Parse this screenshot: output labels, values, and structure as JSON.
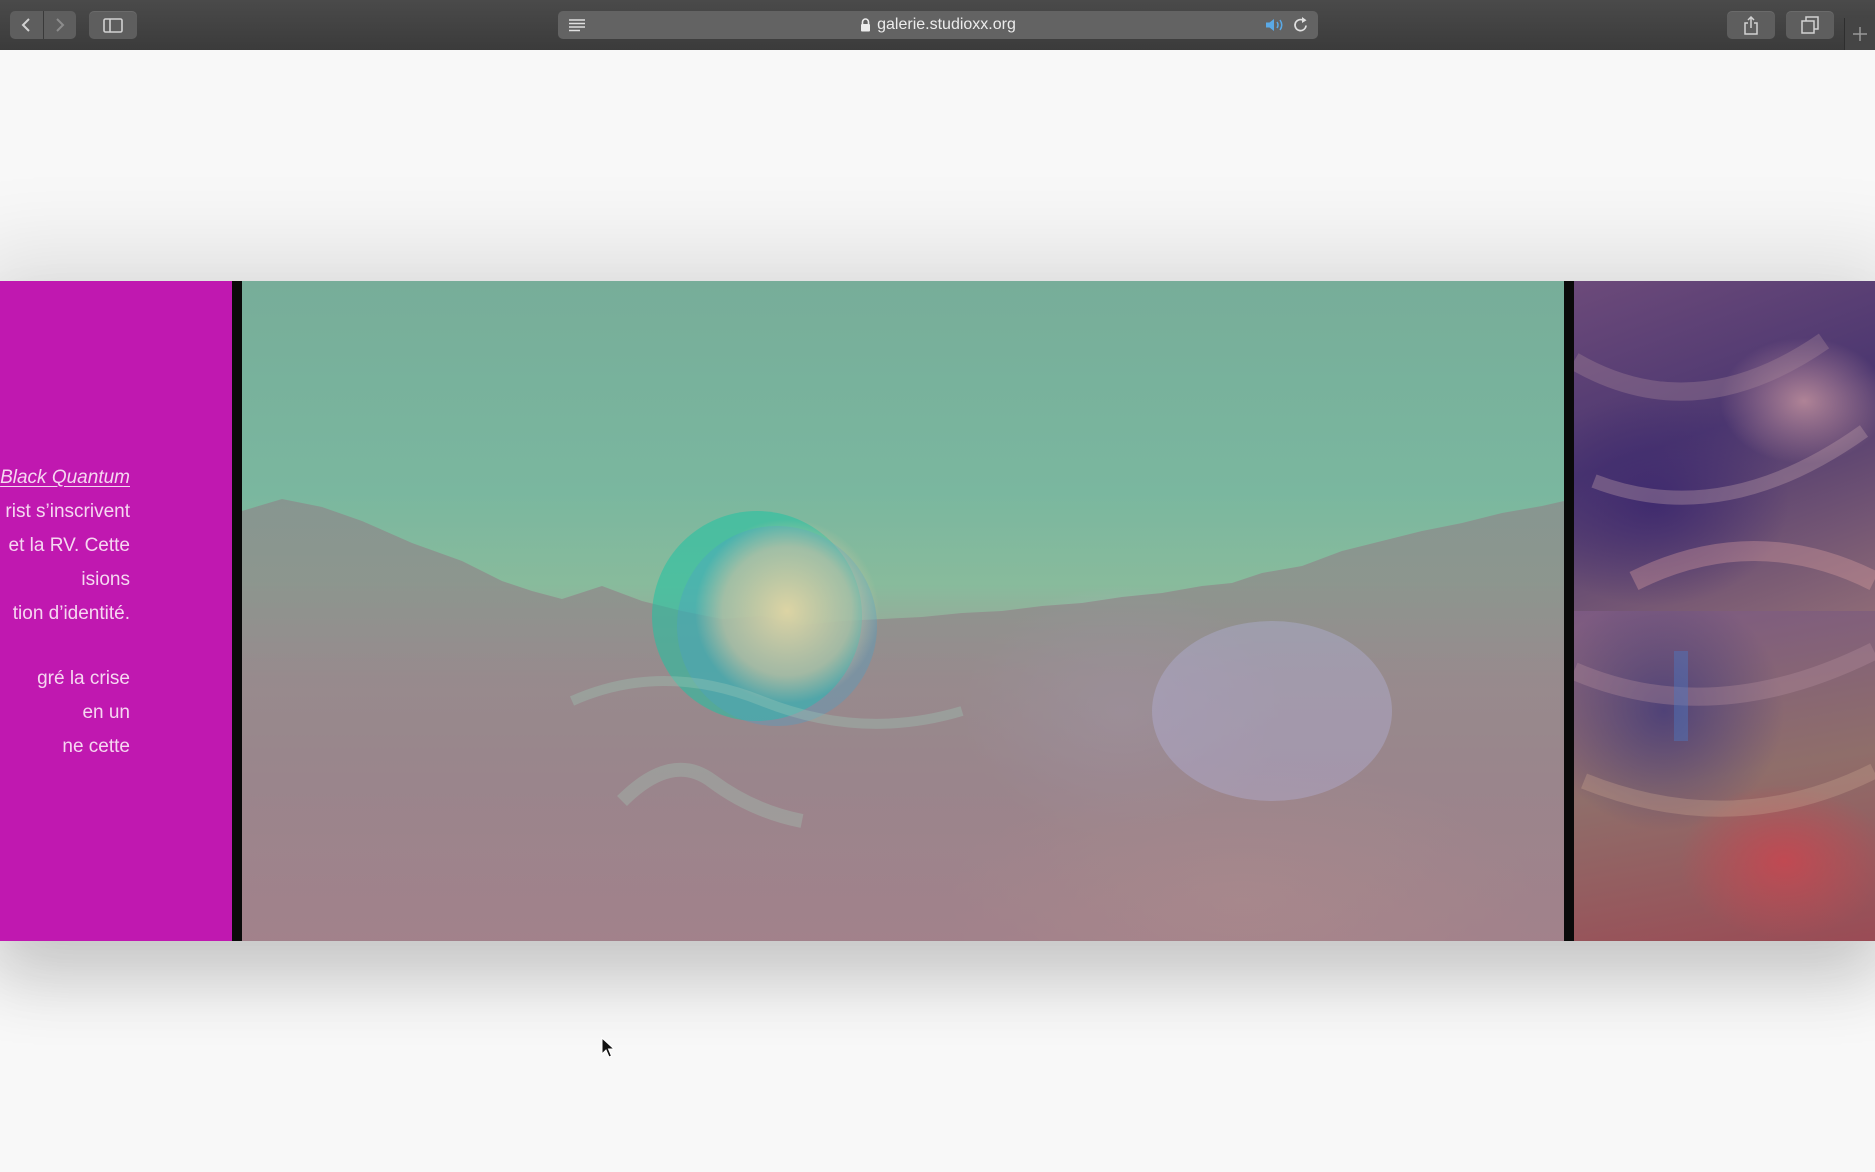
{
  "browser": {
    "url": "galerie.studioxx.org",
    "icons": {
      "back": "chevron-left-icon",
      "forward": "chevron-right-icon",
      "sidebar": "sidebar-icon",
      "reader": "reader-view-icon",
      "lock": "lock-icon",
      "audio": "speaker-icon",
      "reload": "reload-icon",
      "share": "share-icon",
      "tabs": "tab-overview-icon",
      "new_tab": "plus-icon"
    }
  },
  "gallery": {
    "description_lines": [
      {
        "link": "Black Quantum",
        "text": ""
      },
      {
        "link": "",
        "text": "rist s’inscrivent"
      },
      {
        "link": "",
        "text": "et la RV. Cette"
      },
      {
        "link": "",
        "text": "isions"
      },
      {
        "link": "",
        "text": "tion d’identité."
      },
      {
        "link": "",
        "text": "gré la crise"
      },
      {
        "link": "",
        "text": "en un"
      },
      {
        "link": "",
        "text": "ne cette"
      }
    ]
  },
  "colors": {
    "panel": "#c018b0",
    "panel_text": "#f6d7f1",
    "toolbar": "#3f3f3f",
    "page_bg": "#f8f8f8"
  }
}
